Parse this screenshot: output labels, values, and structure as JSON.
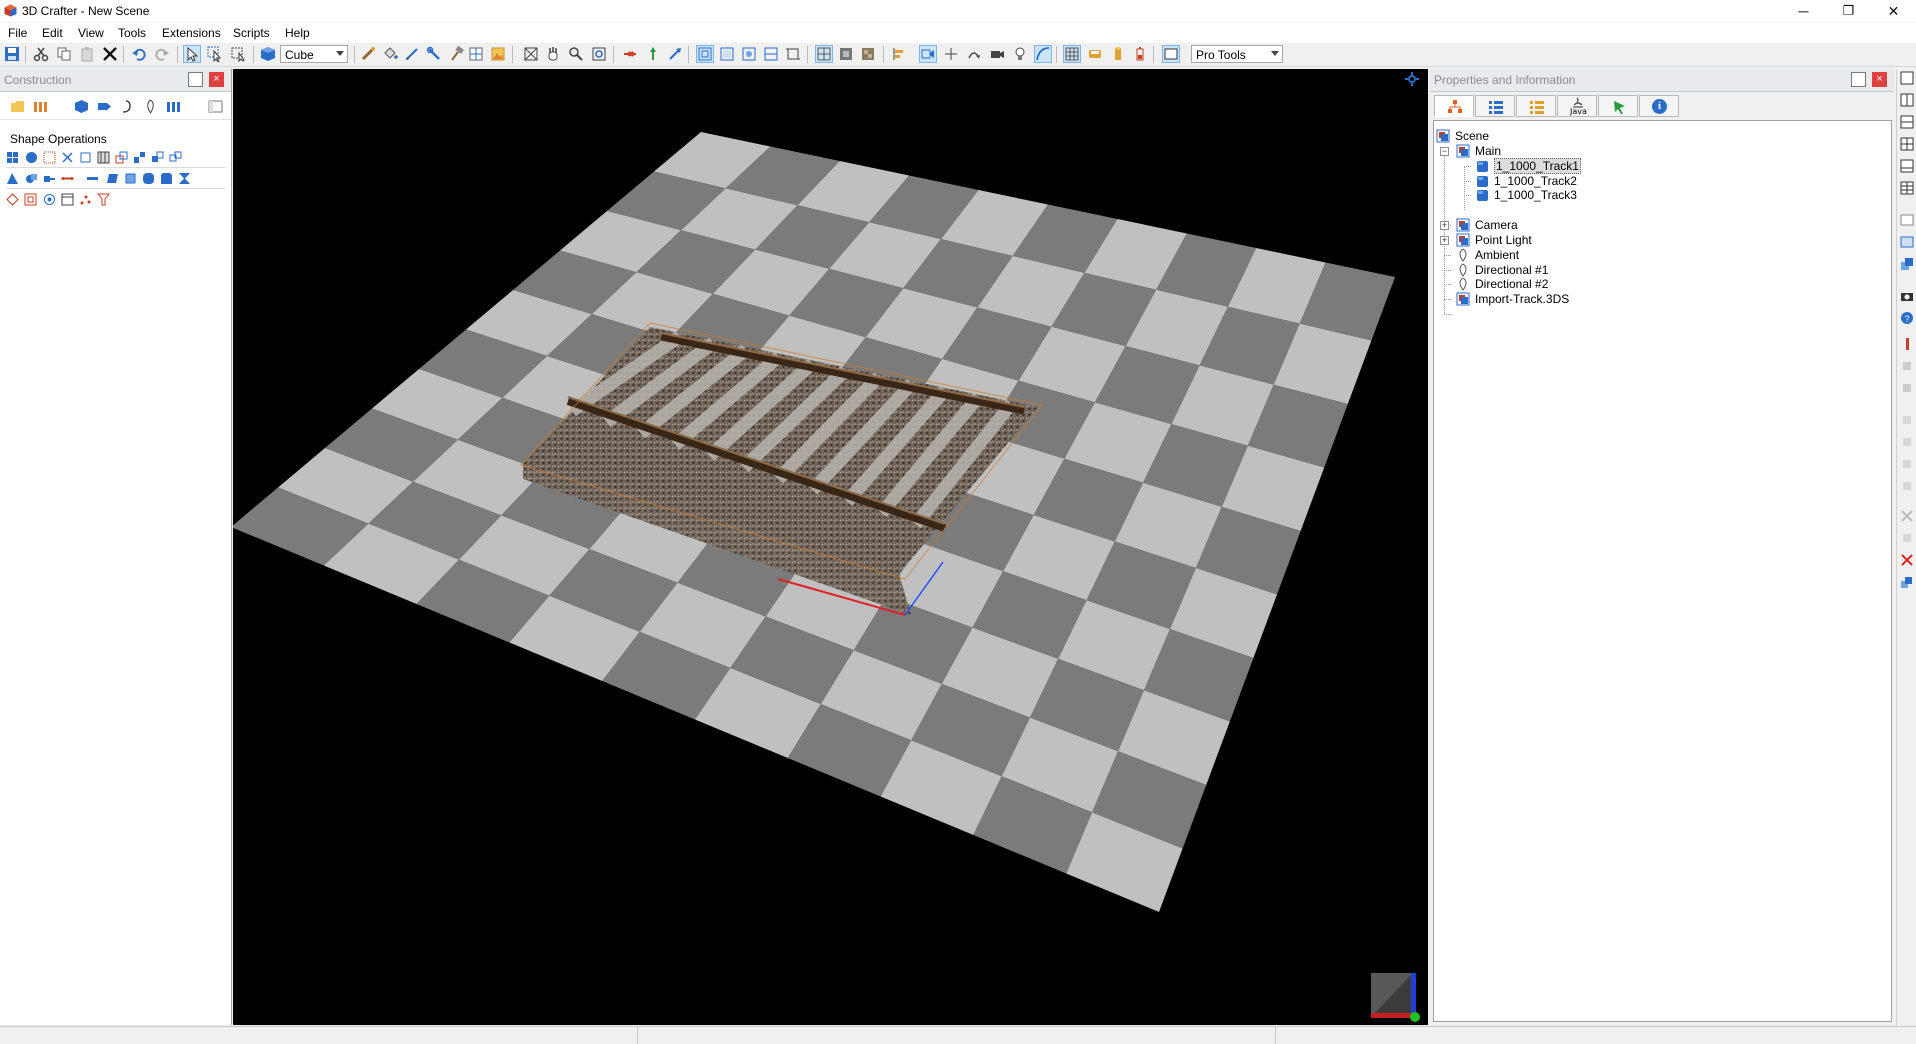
{
  "window": {
    "title": "3D Crafter - New Scene",
    "minimize_glyph": "─",
    "restore_glyph": "❐",
    "close_glyph": "✕"
  },
  "menu": [
    "File",
    "Edit",
    "View",
    "Tools",
    "Extensions",
    "Scripts",
    "Help"
  ],
  "toolbar": {
    "shape_select_value": "Cube",
    "tools_select_value": "Pro Tools"
  },
  "left_panel": {
    "title": "Construction",
    "close_glyph": "×",
    "section_title": "Shape Operations"
  },
  "right_panel": {
    "title": "Properties and Information",
    "close_glyph": "×",
    "tabs": [
      {
        "name": "scene-tree-icon",
        "label": ""
      },
      {
        "name": "list-icon",
        "label": ""
      },
      {
        "name": "detail-list-icon",
        "label": ""
      },
      {
        "name": "java-icon",
        "label": "Java"
      },
      {
        "name": "pointer-icon",
        "label": ""
      },
      {
        "name": "info-icon",
        "label": "i"
      }
    ],
    "tree": {
      "scene": "Scene",
      "main": "Main",
      "track1": "1_1000_Track1",
      "track2": "1_1000_Track2",
      "track3": "1_1000_Track3",
      "camera": "Camera",
      "point_light": "Point Light",
      "ambient": "Ambient",
      "directional1": "Directional #1",
      "directional2": "Directional #2",
      "import": "Import-Track.3DS"
    },
    "expander_minus": "−",
    "expander_plus": "+"
  },
  "colors": {
    "floor_light": "#c0c0c0",
    "floor_dark": "#7b7b7b",
    "viewport_bg": "#000000",
    "selection_outline": "#d07a2a",
    "axis_x": "#e02020",
    "axis_y": "#20c020",
    "axis_z": "#2050ff",
    "accent_blue": "#2a6cc7"
  }
}
